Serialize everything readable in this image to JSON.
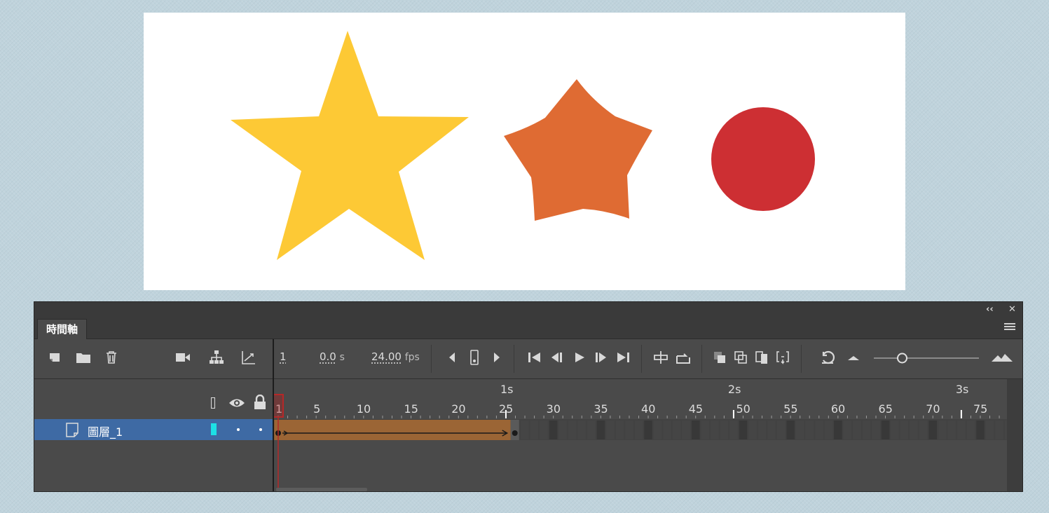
{
  "stage": {
    "shapes": [
      {
        "kind": "star",
        "color": "#fdc935"
      },
      {
        "kind": "rounded-star",
        "color": "#df6b33"
      },
      {
        "kind": "circle",
        "color": "#cd2f33"
      }
    ]
  },
  "panel": {
    "tab_label": "時間軸",
    "collapse_icon": "double-chevron-left-icon",
    "close_icon": "close-icon",
    "menu_icon": "hamburger-menu-icon"
  },
  "toolbar": {
    "current_frame": "1",
    "elapsed_time": "0.0",
    "time_unit": "s",
    "frame_rate": "24.00",
    "fps_unit": "fps",
    "icons": [
      "new-layer-icon",
      "new-folder-icon",
      "delete-icon",
      "camera-icon",
      "parenting-icon",
      "layer-depth-icon",
      "step-back-icon",
      "insert-keyframe-icon",
      "step-forward-icon",
      "go-first-icon",
      "prev-frame-icon",
      "play-icon",
      "next-frame-icon",
      "go-last-icon",
      "center-frame-icon",
      "loop-icon",
      "onion-skin-icon",
      "onion-outline-icon",
      "edit-multiple-icon",
      "onion-markers-icon",
      "undo-icon",
      "zoom-out-icon",
      "zoom-slider",
      "zoom-in-icon"
    ],
    "zoom_level": 0.27
  },
  "timeline": {
    "seconds_labels": [
      "1s",
      "2s",
      "3s"
    ],
    "frame_labels": [
      "1",
      "5",
      "10",
      "15",
      "20",
      "25",
      "30",
      "35",
      "40",
      "45",
      "50",
      "55",
      "60",
      "65",
      "70",
      "75"
    ],
    "playhead_frame": 1,
    "total_visible_frames": 77,
    "tween": {
      "start": 1,
      "end": 25,
      "color": "#9b6535",
      "type": "motion"
    }
  },
  "layers": [
    {
      "name": "圖層_1",
      "outline_color": "#1de0e6",
      "visible": true,
      "locked": false
    }
  ]
}
